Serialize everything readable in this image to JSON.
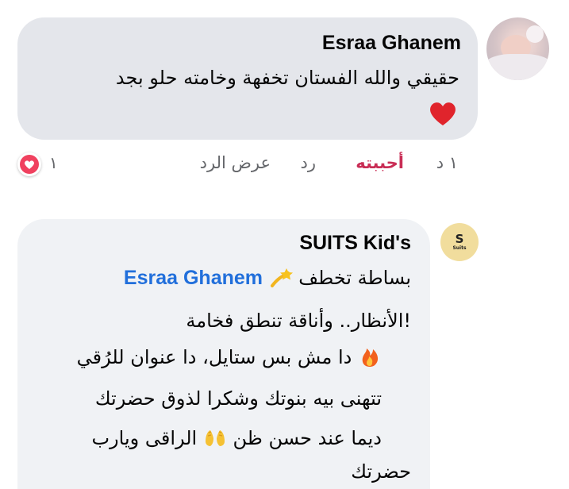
{
  "comments": [
    {
      "author": "Esraa Ghanem",
      "text": "حقيقي والله الفستان تخفهة وخامته حلو بجد",
      "emoji": "red-heart",
      "actions": {
        "time": "١ د",
        "like": "أحببته",
        "reply": "رد",
        "view_reply": "عرض الرد"
      },
      "reaction_count": "١",
      "reaction": "love"
    },
    {
      "author": "SUITS Kid's",
      "avatar_logo": "S",
      "avatar_caption": "Suits",
      "lines": {
        "l1_prefix": "بساطة تخطف",
        "l1_mention": "Esraa Ghanem",
        "l2": "!الأنظار.. وأناقة تنطق فخامة",
        "l3": "دا مش بس ستايل، دا عنوان للرُقي",
        "l4": "تتهنى بيه بنوتك  وشكرا لذوق حضرتك",
        "l5_a": "الراقى  ويارب",
        "l5_b": "ديما عند حسن ظن",
        "l6": "حضرتك"
      }
    }
  ],
  "colors": {
    "bubble_primary": "#e4e6eb",
    "bubble_secondary": "#f0f2f5",
    "like_active": "#c92d55",
    "mention": "#216fdb",
    "muted": "#65676b"
  }
}
